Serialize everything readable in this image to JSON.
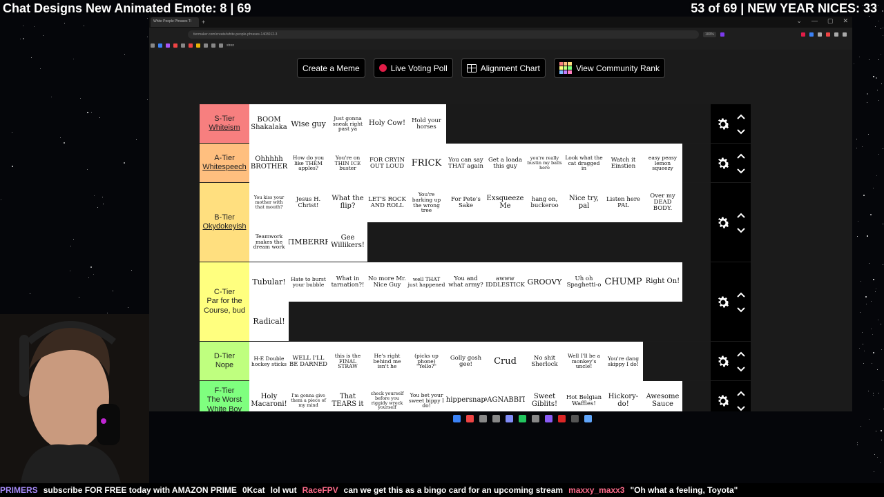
{
  "overlay": {
    "left_text": "Chat Designs New Animated Emote: 8 | 69",
    "right_text": "53 of 69 | NEW YEAR NICES: 33"
  },
  "browser": {
    "tab_title": "White People Phrases Ti",
    "new_tab": "+",
    "url": "tiermaker.com/create/white-people-phrases-1403012-3",
    "zoom": "100%",
    "bookmark_folder": "stren",
    "window_controls": [
      "⌄",
      "—",
      "▢",
      "✕"
    ]
  },
  "nav": {
    "create_meme": "Create a Meme",
    "live_voting": "Live Voting Poll",
    "alignment": "Alignment Chart",
    "community_rank": "View Community Rank"
  },
  "colors": {
    "S": "#f77f7f",
    "A": "#ffbf7f",
    "B": "#ffdf7f",
    "C": "#ffff7f",
    "D": "#bfff7f",
    "F": "#7fff7f"
  },
  "tiers": [
    {
      "key": "S",
      "name": "S-Tier",
      "sub": "Whiteism",
      "items": [
        "BOOM Shakalaka",
        "Wise guy",
        "Just gonna sneak right past ya",
        "Holy Cow!",
        "Hold your horses"
      ]
    },
    {
      "key": "A",
      "name": "A-Tier",
      "sub": "Whitespeech",
      "items": [
        "Ohhhhh BROTHER",
        "How do you like THEM apples?",
        "You're on THIN ICE buster",
        "FOR CRYIN OUT LOUD",
        "FRICK",
        "You can say THAT again",
        "Get a loada this guy",
        "you're really bustin my balls here",
        "Look what the cat dragged in",
        "Watch it Einstien",
        "easy peasy lemon squeezy"
      ]
    },
    {
      "key": "B",
      "name": "B-Tier",
      "sub": "Okydokeyish",
      "items": [
        "You kiss your mother with that mouth?",
        "Jesus H. Christ!",
        "What the flip?",
        "LET'S ROCK AND ROLL",
        "You're barking up the wrong tree",
        "For Pete's Sake",
        "Exsqueeze Me",
        "hang on, buckeroo",
        "Nice try, pal",
        "Listen here PAL",
        "Over my DEAD BODY.",
        "Teamwork makes the dream work",
        "TIMBERRR",
        "Gee Willikers!"
      ]
    },
    {
      "key": "C",
      "name": "C-Tier",
      "sub": "Par for the Course, bud",
      "items": [
        "Tubular!",
        "Hate to burst your bubble",
        "What in tarnation?!",
        "No more Mr. Nice Guy",
        "well THAT just happened",
        "You and what army?",
        "awww FIDDLESTICKS",
        "GROOVY",
        "Uh oh Spaghetti-o",
        "CHUMP",
        "Right On!",
        "Radical!"
      ]
    },
    {
      "key": "D",
      "name": "D-Tier",
      "sub": "Nope",
      "items": [
        "H-E Double hockey sticks",
        "WELL I'LL BE DARNED",
        "this is the FINAL STRAW",
        "He's right behind me isn't he",
        "(picks up phone) \"Yello?\"",
        "Golly gosh gee!",
        "Crud",
        "No shit Sherlock",
        "Well I'll be a monkey's uncle!",
        "You're dang skippy I do!"
      ]
    },
    {
      "key": "F",
      "name": "F-Tier",
      "sub": "The Worst White Boy",
      "items": [
        "Holy Macaroni!",
        "I'm gonna give them a piece of my mind",
        "That TEARS it",
        "check yourself before you riggidy wreck yourself",
        "You bet your sweet bippy I do!",
        "Whippersnaper",
        "DAGNABBIT!",
        "Sweet Giblits!",
        "Hot Belgian Waffles!",
        "Hickory-do!",
        "Awesome Sauce"
      ]
    }
  ],
  "ticker": [
    {
      "user": "PRIMERS",
      "text": "subscribe FOR FREE today with AMAZON PRIME",
      "color": "#a78bfa"
    },
    {
      "user": "0Kcat",
      "text": "lol wut",
      "color": "#ffffff"
    },
    {
      "user": "RaceFPV",
      "text": "can we get this as a bingo card for an upcoming stream",
      "color": "#ff6b8a"
    },
    {
      "user": "maxxy_maxx3",
      "text": "\"Oh what a feeling, Toyota\"",
      "color": "#ff6b8a"
    }
  ]
}
